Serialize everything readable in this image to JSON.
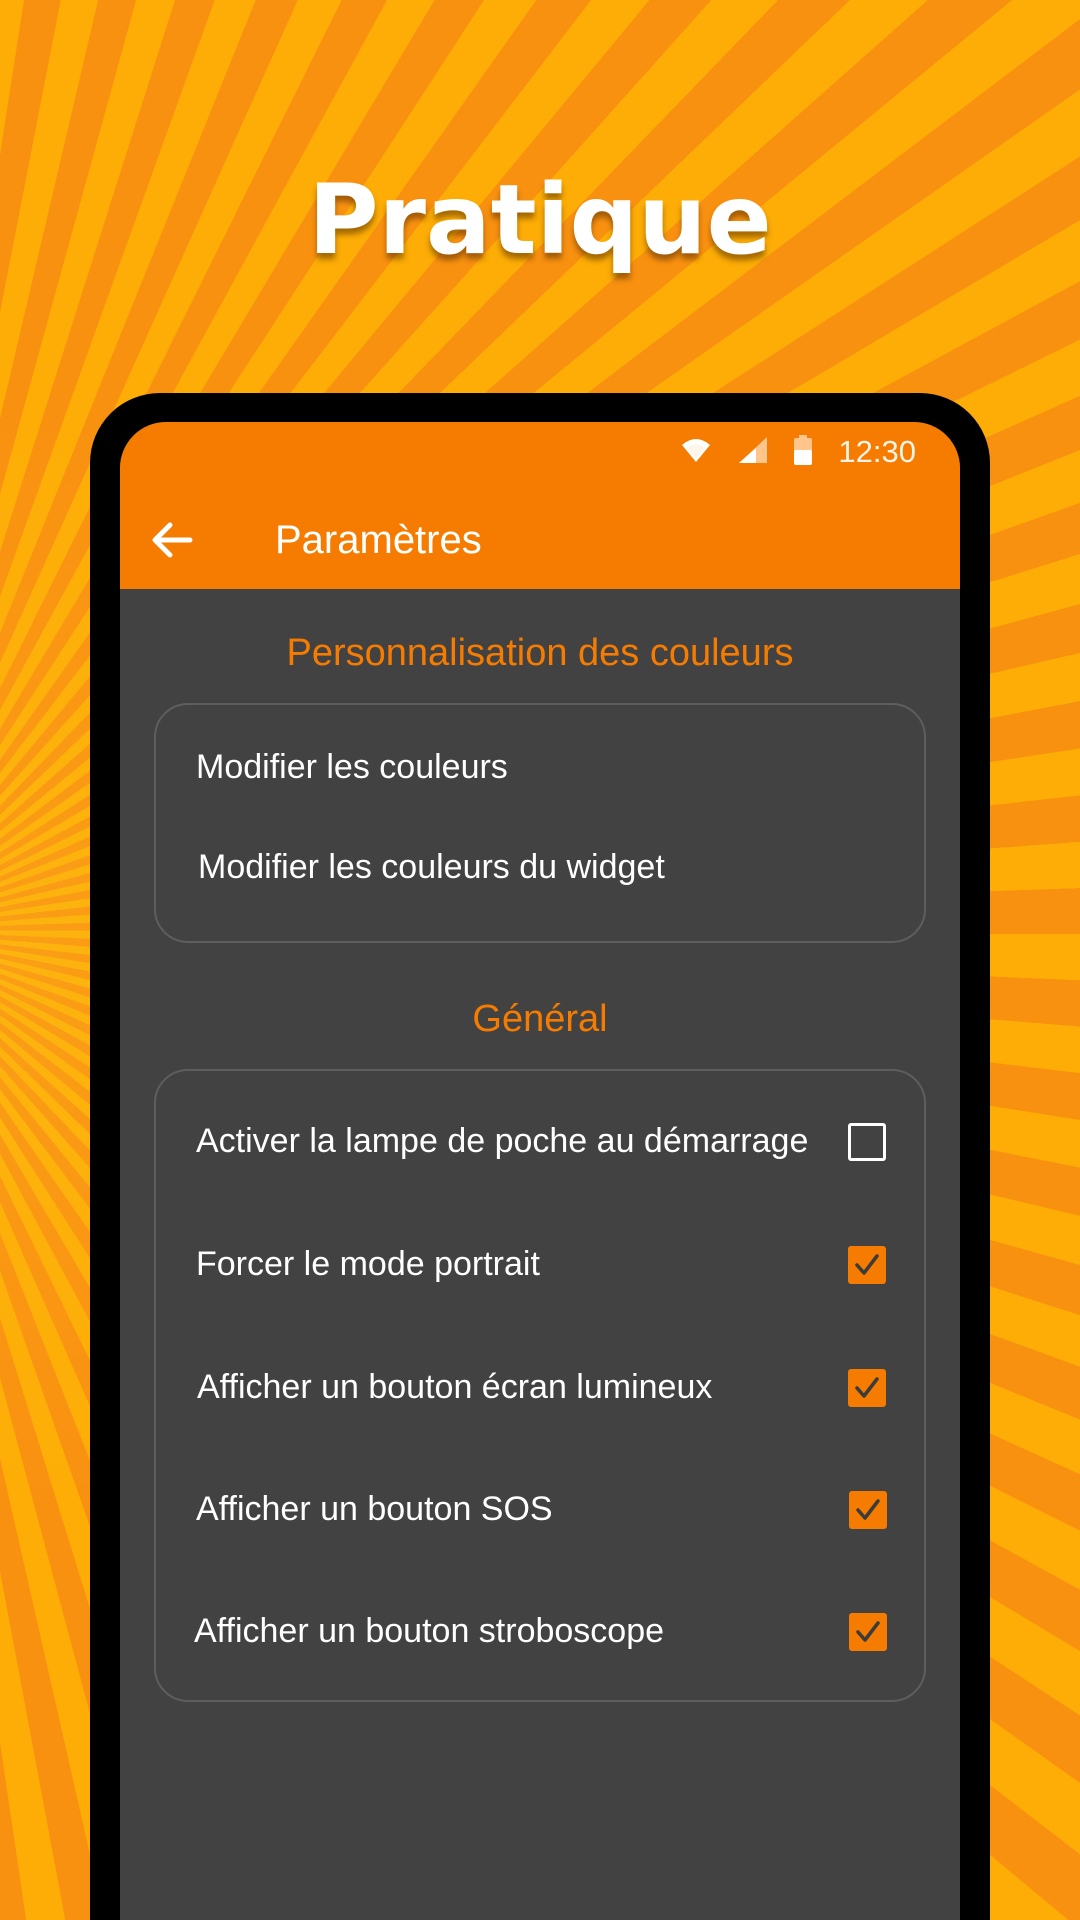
{
  "headline": "Pratique",
  "status_bar": {
    "time": "12:30",
    "icons": [
      "wifi-icon",
      "signal-icon",
      "battery-icon"
    ]
  },
  "toolbar": {
    "back_icon": "arrow-left-icon",
    "title": "Paramètres"
  },
  "colors": {
    "accent": "#f57c00",
    "surface": "#424242",
    "background_stripes": [
      "#f99110",
      "#fdad06"
    ]
  },
  "sections": {
    "colors": {
      "title": "Personnalisation des couleurs",
      "items": [
        {
          "label": "Modifier les couleurs"
        },
        {
          "label": "Modifier les couleurs du widget"
        }
      ]
    },
    "general": {
      "title": "Général",
      "items": [
        {
          "label": "Activer la lampe de poche au démarrage",
          "checked": false
        },
        {
          "label": "Forcer le mode portrait",
          "checked": true
        },
        {
          "label": "Afficher un bouton écran lumineux",
          "checked": true
        },
        {
          "label": "Afficher un bouton SOS",
          "checked": true
        },
        {
          "label": "Afficher un bouton stroboscope",
          "checked": true
        }
      ]
    }
  }
}
